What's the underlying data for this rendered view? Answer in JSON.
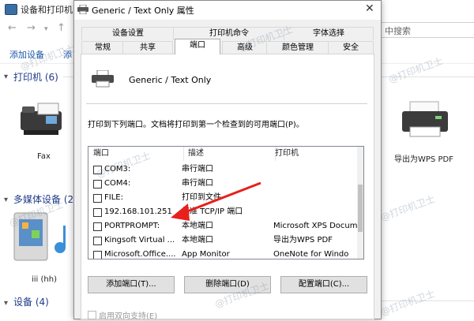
{
  "background_window": {
    "title": "设备和打印机",
    "search_placeholder": "中搜索",
    "cmdbar": {
      "add_device": "添加设备",
      "add_printer_partial": "添"
    },
    "sections": {
      "printers": "打印机 (6)",
      "multimedia": "多媒体设备 (2",
      "devices": "设备 (4)"
    },
    "devices": {
      "fax_label": "Fax",
      "pdf_label": "导出为WPS PDF",
      "media_label": "iii (hh)"
    }
  },
  "dialog": {
    "title": "Generic / Text Only 属性",
    "close_glyph": "✕",
    "tabs_row1": [
      "设备设置",
      "打印机命令",
      "字体选择"
    ],
    "tabs_row2": [
      "常规",
      "共享",
      "端口",
      "高级",
      "颜色管理",
      "安全"
    ],
    "active_tab": "端口",
    "printer_name": "Generic / Text Only",
    "instruction": "打印到下列端口。文档将打印到第一个检查到的可用端口(P)。",
    "ports_table": {
      "headers": [
        "端口",
        "描述",
        "打印机"
      ],
      "rows": [
        {
          "port": "COM3:",
          "desc": "串行端口",
          "printer": ""
        },
        {
          "port": "COM4:",
          "desc": "串行端口",
          "printer": ""
        },
        {
          "port": "FILE:",
          "desc": "打印到文件",
          "printer": ""
        },
        {
          "port": "192.168.101.251",
          "desc": "标准 TCP/IP 端口",
          "printer": ""
        },
        {
          "port": "PORTPROMPT:",
          "desc": "本地端口",
          "printer": "Microsoft XPS Docum"
        },
        {
          "port": "Kingsoft Virtual ...",
          "desc": "本地端口",
          "printer": "导出为WPS PDF"
        },
        {
          "port": "Microsoft.Office....",
          "desc": "App Monitor",
          "printer": "OneNote for Windo"
        }
      ]
    },
    "buttons": {
      "add_port": "添加端口(T)...",
      "delete_port": "删除端口(D)",
      "configure_port": "配置端口(C)..."
    },
    "bidir_label": "启用双向支持(E)"
  },
  "watermark": "@打印机卫士",
  "colors": {
    "annotation_arrow": "#e8201b",
    "section_text": "#1e3a8a",
    "link_text": "#1a56a8"
  }
}
